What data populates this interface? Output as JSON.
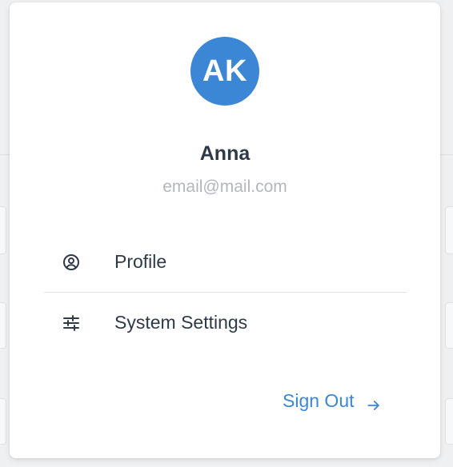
{
  "user": {
    "initials": "AK",
    "name": "Anna",
    "email": "email@mail.com"
  },
  "menu": {
    "items": [
      {
        "label": "Profile",
        "icon": "user-circle-icon"
      },
      {
        "label": "System Settings",
        "icon": "sliders-icon"
      }
    ]
  },
  "actions": {
    "sign_out_label": "Sign Out",
    "sign_out_icon": "arrow-right-icon"
  },
  "colors": {
    "accent": "#3b87d6",
    "text": "#2f3a48",
    "muted": "#b3b7bc",
    "background": "#ffffff"
  }
}
